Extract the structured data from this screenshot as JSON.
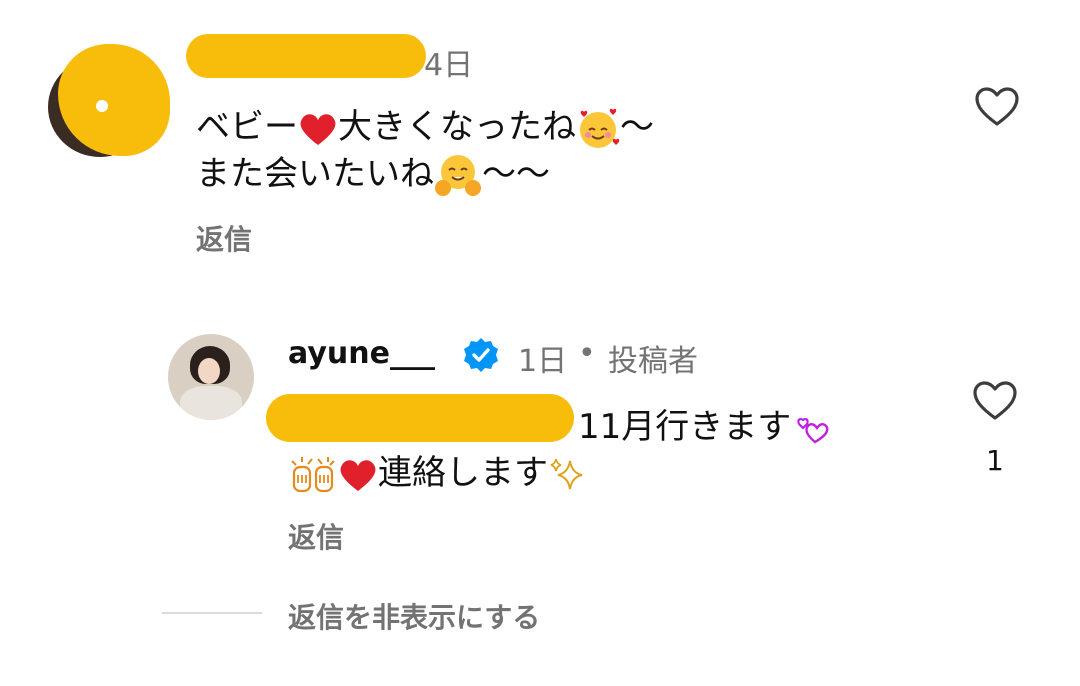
{
  "comment1": {
    "time": "4日",
    "line1_a": "ベビー",
    "line1_b": "大きくなったね",
    "line1_c": "〜",
    "line2_a": "また会いたいね",
    "line2_b": "〜〜",
    "reply_label": "返信"
  },
  "comment2": {
    "username": "ayune___",
    "time": "1日",
    "separator": "•",
    "author_badge": "投稿者",
    "line1": "11月行きます",
    "line2": "連絡します",
    "reply_label": "返信",
    "like_count": "1"
  },
  "hide_replies_label": "返信を非表示にする",
  "colors": {
    "redaction": "#f8bd0b",
    "verified": "#0095f6",
    "muted": "#737373"
  },
  "icons": [
    "heart-outline-icon",
    "verified-badge-icon",
    "red-heart-emoji",
    "smiling-hearts-emoji",
    "hug-emoji",
    "heart-decoration-emoji",
    "raised-hands-emoji",
    "sparkles-emoji"
  ]
}
